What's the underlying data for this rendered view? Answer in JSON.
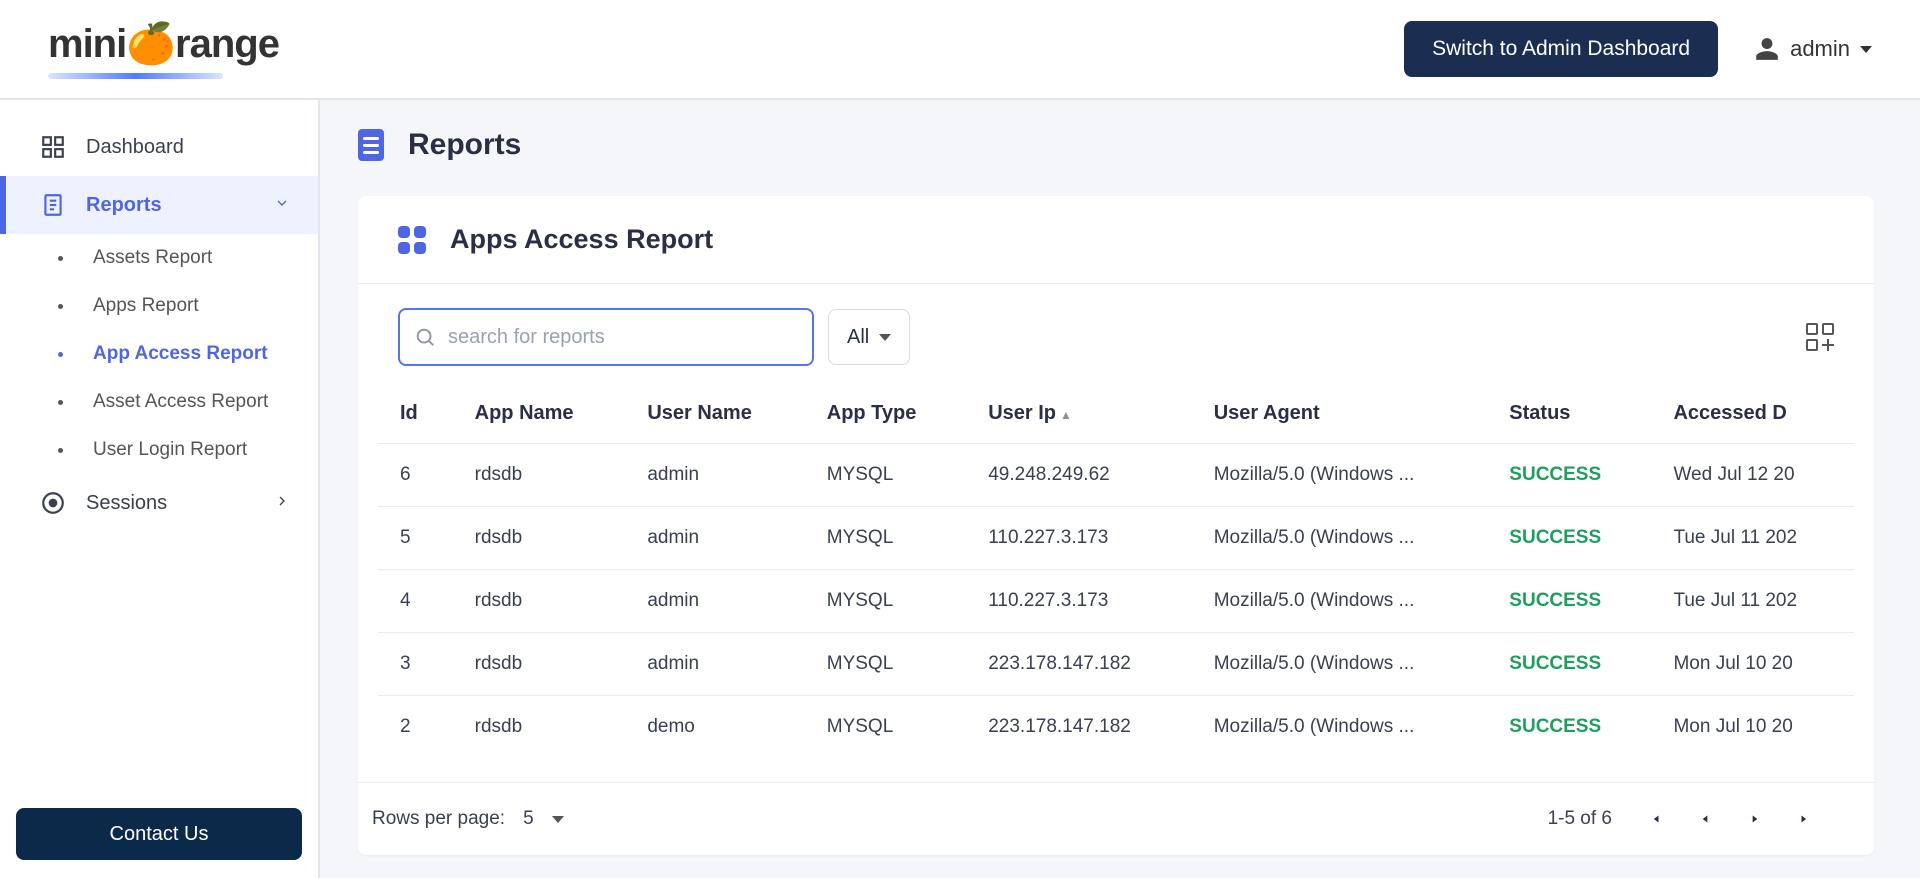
{
  "header": {
    "logo_text_a": "mini",
    "logo_text_b": "range",
    "button_admin": "Switch to Admin Dashboard",
    "user_name": "admin"
  },
  "sidebar": {
    "items": [
      {
        "label": "Dashboard"
      },
      {
        "label": "Reports"
      },
      {
        "label": "Sessions"
      }
    ],
    "reports_sub": [
      {
        "label": "Assets Report"
      },
      {
        "label": "Apps Report"
      },
      {
        "label": "App Access Report"
      },
      {
        "label": "Asset Access Report"
      },
      {
        "label": "User Login Report"
      }
    ],
    "contact_us": "Contact Us"
  },
  "page": {
    "title": "Reports",
    "card_title": "Apps Access Report",
    "search_placeholder": "search for reports",
    "filter_select": "All"
  },
  "table": {
    "headers": {
      "id": "Id",
      "app_name": "App Name",
      "user_name": "User Name",
      "app_type": "App Type",
      "user_ip": "User Ip",
      "sort_indicator": "▲",
      "user_agent": "User Agent",
      "status": "Status",
      "accessed": "Accessed D"
    },
    "rows": [
      {
        "id": "6",
        "app_name": "rdsdb",
        "user_name": "admin",
        "app_type": "MYSQL",
        "user_ip": "49.248.249.62",
        "user_agent": "Mozilla/5.0 (Windows ...",
        "status": "SUCCESS",
        "accessed": "Wed Jul 12 20"
      },
      {
        "id": "5",
        "app_name": "rdsdb",
        "user_name": "admin",
        "app_type": "MYSQL",
        "user_ip": "110.227.3.173",
        "user_agent": "Mozilla/5.0 (Windows ...",
        "status": "SUCCESS",
        "accessed": "Tue Jul 11 202"
      },
      {
        "id": "4",
        "app_name": "rdsdb",
        "user_name": "admin",
        "app_type": "MYSQL",
        "user_ip": "110.227.3.173",
        "user_agent": "Mozilla/5.0 (Windows ...",
        "status": "SUCCESS",
        "accessed": "Tue Jul 11 202"
      },
      {
        "id": "3",
        "app_name": "rdsdb",
        "user_name": "admin",
        "app_type": "MYSQL",
        "user_ip": "223.178.147.182",
        "user_agent": "Mozilla/5.0 (Windows ...",
        "status": "SUCCESS",
        "accessed": "Mon Jul 10 20"
      },
      {
        "id": "2",
        "app_name": "rdsdb",
        "user_name": "demo",
        "app_type": "MYSQL",
        "user_ip": "223.178.147.182",
        "user_agent": "Mozilla/5.0 (Windows ...",
        "status": "SUCCESS",
        "accessed": "Mon Jul 10 20"
      }
    ]
  },
  "pager": {
    "rows_per_page_label": "Rows per page:",
    "rows_per_page_value": "5",
    "range": "1-5 of 6"
  }
}
